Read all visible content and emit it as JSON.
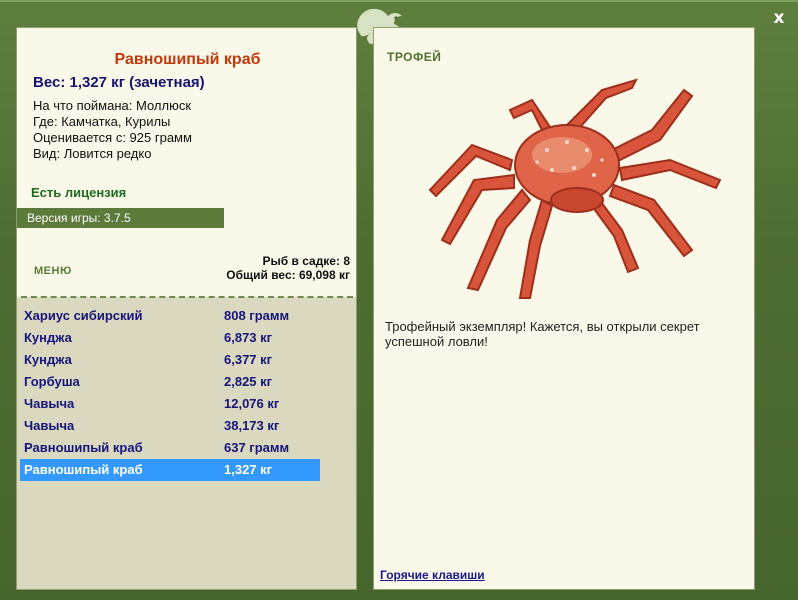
{
  "window": {
    "close_label": "x"
  },
  "fish_info": {
    "title": "Равношипый краб",
    "weight": "Вес: 1,327 кг (зачетная)",
    "lines": [
      "На что поймана: Моллюск",
      "Где: Камчатка, Курилы",
      "Оценивается с: 925 грамм",
      "Вид: Ловится редко"
    ]
  },
  "license": "Есть лицензия",
  "version": "Версия игры: 3.7.5",
  "menu_label": "МЕНЮ",
  "stats": {
    "count": "Рыб в садке: 8",
    "total": "Общий вес: 69,098 кг"
  },
  "catch_list": [
    {
      "name": "Хариус сибирский",
      "weight": "808 грамм"
    },
    {
      "name": "Кунджа",
      "weight": "6,873 кг"
    },
    {
      "name": "Кунджа",
      "weight": "6,377 кг"
    },
    {
      "name": "Горбуша",
      "weight": "2,825 кг"
    },
    {
      "name": "Чавыча",
      "weight": "12,076 кг"
    },
    {
      "name": "Чавыча",
      "weight": "38,173 кг"
    },
    {
      "name": "Равношипый краб",
      "weight": "637 грамм"
    },
    {
      "name": "Равношипый краб",
      "weight": "1,327 кг"
    }
  ],
  "selected_index": 7,
  "trophy": {
    "label": "ТРОФЕЙ",
    "text": "Трофейный экземпляр! Кажется, вы открыли секрет успешной ловли!"
  },
  "hotkeys_label": "Горячие клавиши",
  "colors": {
    "background": "#4b6b32",
    "panel": "#faf8e8",
    "list_area": "#dad8bf",
    "title": "#c0390b",
    "name_text": "#15157a",
    "selected": "#3399ff",
    "license": "#1f6a1f"
  }
}
